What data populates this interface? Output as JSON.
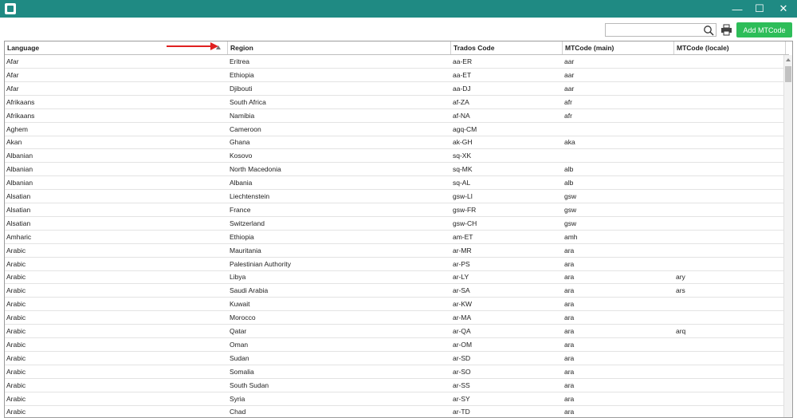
{
  "window": {
    "title": "",
    "controls": {
      "minimize": "—",
      "maximize": "☐",
      "close": "✕"
    }
  },
  "toolbar": {
    "search_placeholder": "",
    "add_button_label": "Add MTCode"
  },
  "table": {
    "columns": [
      "Language",
      "Region",
      "Trados Code",
      "MTCode (main)",
      "MTCode (locale)"
    ],
    "sorted_column": "Language",
    "rows": [
      [
        "Afar",
        "Eritrea",
        "aa-ER",
        "aar",
        ""
      ],
      [
        "Afar",
        "Ethiopia",
        "aa-ET",
        "aar",
        ""
      ],
      [
        "Afar",
        "Djibouti",
        "aa-DJ",
        "aar",
        ""
      ],
      [
        "Afrikaans",
        "South Africa",
        "af-ZA",
        "afr",
        ""
      ],
      [
        "Afrikaans",
        "Namibia",
        "af-NA",
        "afr",
        ""
      ],
      [
        "Aghem",
        "Cameroon",
        "agq-CM",
        "",
        ""
      ],
      [
        "Akan",
        "Ghana",
        "ak-GH",
        "aka",
        ""
      ],
      [
        "Albanian",
        "Kosovo",
        "sq-XK",
        "",
        ""
      ],
      [
        "Albanian",
        "North Macedonia",
        "sq-MK",
        "alb",
        ""
      ],
      [
        "Albanian",
        "Albania",
        "sq-AL",
        "alb",
        ""
      ],
      [
        "Alsatian",
        "Liechtenstein",
        "gsw-LI",
        "gsw",
        ""
      ],
      [
        "Alsatian",
        "France",
        "gsw-FR",
        "gsw",
        ""
      ],
      [
        "Alsatian",
        "Switzerland",
        "gsw-CH",
        "gsw",
        ""
      ],
      [
        "Amharic",
        "Ethiopia",
        "am-ET",
        "amh",
        ""
      ],
      [
        "Arabic",
        "Mauritania",
        "ar-MR",
        "ara",
        ""
      ],
      [
        "Arabic",
        "Palestinian Authority",
        "ar-PS",
        "ara",
        ""
      ],
      [
        "Arabic",
        "Libya",
        "ar-LY",
        "ara",
        "ary"
      ],
      [
        "Arabic",
        "Saudi Arabia",
        "ar-SA",
        "ara",
        "ars"
      ],
      [
        "Arabic",
        "Kuwait",
        "ar-KW",
        "ara",
        ""
      ],
      [
        "Arabic",
        "Morocco",
        "ar-MA",
        "ara",
        ""
      ],
      [
        "Arabic",
        "Qatar",
        "ar-QA",
        "ara",
        "arq"
      ],
      [
        "Arabic",
        "Oman",
        "ar-OM",
        "ara",
        ""
      ],
      [
        "Arabic",
        "Sudan",
        "ar-SD",
        "ara",
        ""
      ],
      [
        "Arabic",
        "Somalia",
        "ar-SO",
        "ara",
        ""
      ],
      [
        "Arabic",
        "South Sudan",
        "ar-SS",
        "ara",
        ""
      ],
      [
        "Arabic",
        "Syria",
        "ar-SY",
        "ara",
        ""
      ],
      [
        "Arabic",
        "Chad",
        "ar-TD",
        "ara",
        ""
      ]
    ]
  },
  "colors": {
    "titlebar": "#1f8a83",
    "add_button": "#2ebd59",
    "annotation_arrow": "#e02020"
  }
}
